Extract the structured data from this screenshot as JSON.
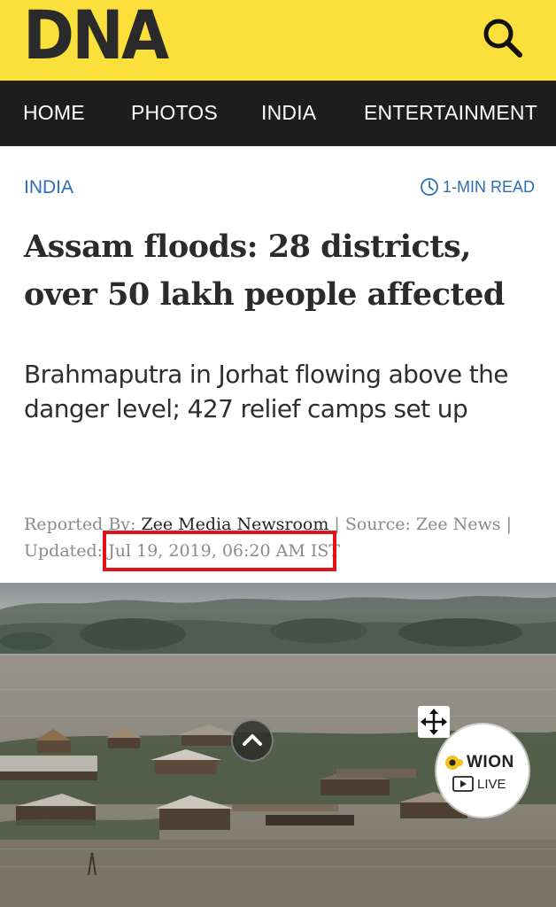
{
  "header": {
    "logo_text": "DNA",
    "brand_color": "#fbe03b",
    "search_icon": "search-icon"
  },
  "nav": {
    "items": [
      {
        "label": "HOME"
      },
      {
        "label": "PHOTOS"
      },
      {
        "label": "INDIA"
      },
      {
        "label": "ENTERTAINMENT"
      }
    ]
  },
  "article": {
    "category": "INDIA",
    "read_time": "1-MIN READ",
    "read_time_icon": "clock-icon",
    "headline": "Assam floods: 28 districts, over 50 lakh people affected",
    "subheadline": "Brahmaputra in Jorhat flowing above the danger level; 427 relief camps set up",
    "meta": {
      "reported_by_label": "Reported By: ",
      "author": "Zee Media Newsroom",
      "source_text": " | Source: Zee News |",
      "updated_label": "Updated: ",
      "updated_date": "Jul 19, 2019, 06:20 AM IST"
    },
    "highlight_color": "#e0131b"
  },
  "overlay": {
    "scroll_top_icon": "chevron-up-icon",
    "move_icon": "move-arrows-icon",
    "wion_brand": "WION",
    "wion_live": "LIVE"
  }
}
